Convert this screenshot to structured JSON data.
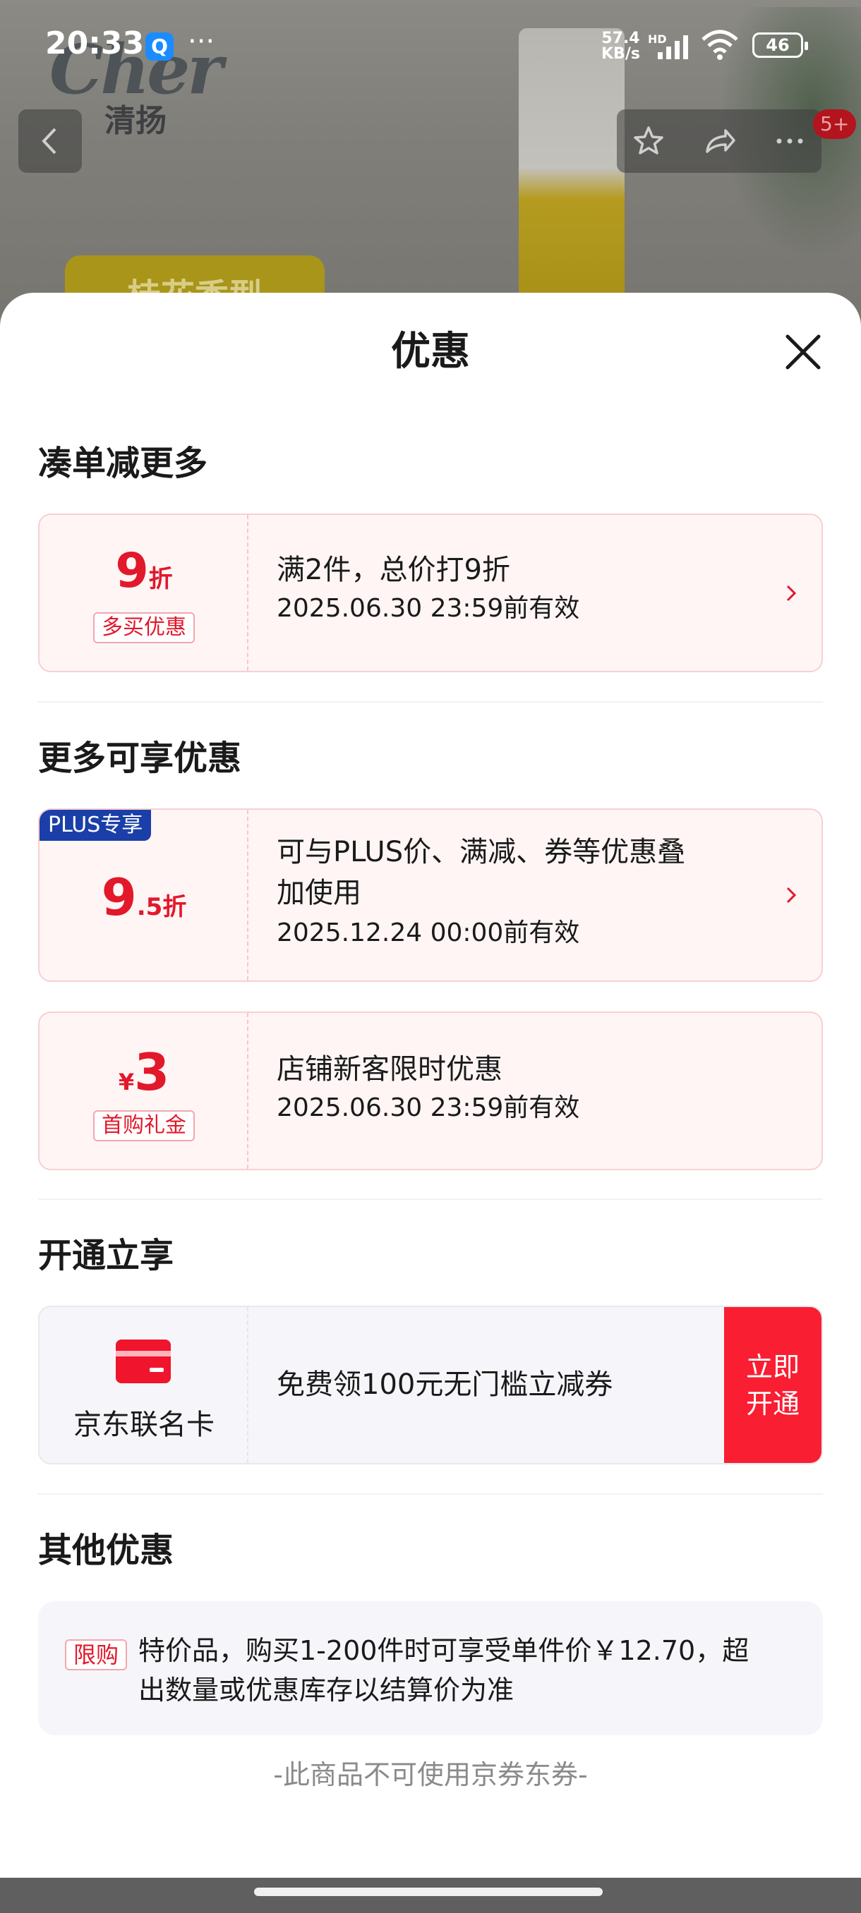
{
  "status_bar": {
    "time": "20:33",
    "app_icon_letter": "Q",
    "more_dots": "···",
    "net_speed_value": "57.4",
    "net_speed_unit": "KB/s",
    "hd": "HD",
    "battery": "46"
  },
  "background": {
    "brand_logo": "Cher",
    "brand_cn": "清扬",
    "scent_badge": "桂花香型",
    "notification_count": "5+"
  },
  "sheet": {
    "title": "优惠",
    "sections": {
      "bundle": {
        "title": "凑单减更多",
        "coupon": {
          "value": "9",
          "unit": "折",
          "tag": "多买优惠",
          "desc": "满2件，总价打9折",
          "valid": "2025.06.30 23:59前有效"
        }
      },
      "more": {
        "title": "更多可享优惠",
        "plus_coupon": {
          "plus_tag": "PLUS专享",
          "value": "9",
          "decimal": ".5",
          "unit": "折",
          "desc_line1": "可与PLUS价、满减、券等优惠叠",
          "desc_line2": "加使用",
          "valid": "2025.12.24 00:00前有效"
        },
        "new_customer": {
          "currency": "¥",
          "value": "3",
          "tag": "首购礼金",
          "desc": "店铺新客限时优惠",
          "valid": "2025.06.30 23:59前有效"
        }
      },
      "open": {
        "title": "开通立享",
        "card": {
          "name": "京东联名卡",
          "desc": "免费领100元无门槛立减券",
          "button_line1": "立即",
          "button_line2": "开通"
        }
      },
      "other": {
        "title": "其他优惠",
        "tag": "限购",
        "text_line1": "特价品，购买1-200件时可享受单件价￥12.70，超",
        "text_line2": "出数量或优惠库存以结算价为准",
        "footer": "-此商品不可使用京券东券-"
      }
    }
  },
  "colors": {
    "accent_red": "#e2182b",
    "button_red": "#fa1e32",
    "plus_blue": "#1b3fa8",
    "coupon_bg": "#fff5f5"
  }
}
